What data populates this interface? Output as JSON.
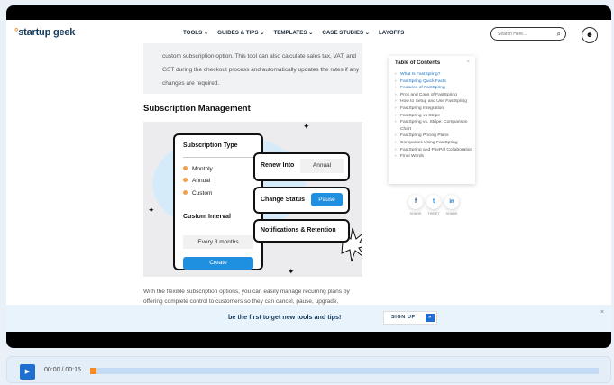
{
  "nav": {
    "logo_brand": "startup geek",
    "menu": [
      "TOOLS",
      "GUIDES & TIPS",
      "TEMPLATES",
      "CASE STUDIES",
      "LAYOFFS"
    ],
    "search_placeholder": "Search Here...",
    "dropdown_marks": [
      "⌄",
      "⌄",
      "⌄",
      "⌄"
    ]
  },
  "content": {
    "intro_text": "custom subscription option. This tool can also calculate sales tax, VAT, and GST during the checkout process and automatically updates the rates if any changes are required.",
    "heading": "Subscription Management",
    "paragraph": "With the flexible subscription options, you can easily manage recurring plans by offering complete control to customers so they can cancel, pause, upgrade,"
  },
  "illustration": {
    "card_title": "Subscription Type",
    "options": [
      "Monthly",
      "Annual",
      "Custom"
    ],
    "custom_interval": "Custom Interval",
    "every_value": "Every 3 months",
    "create_label": "Create",
    "renew_label": "Renew Into",
    "renew_value": "Annual",
    "status_label": "Change Status",
    "status_value": "Pause",
    "notifications_label": "Notifications & Retention",
    "bullet_color": "#f0a04b",
    "button_color": "#1f8fe0"
  },
  "toc": {
    "title": "Table of Contents",
    "close": "×",
    "items": [
      {
        "label": "What Is FastSpring?",
        "active": true
      },
      {
        "label": "FastSpring Quick Facts",
        "active": true
      },
      {
        "label": "Features of FastSpring",
        "active": true
      },
      {
        "label": "Pros and Cons of FastSpring",
        "active": false
      },
      {
        "label": "How to Setup and Use FastSpring",
        "active": false
      },
      {
        "label": "FastSpring Integration",
        "active": false
      },
      {
        "label": "FastSpring vs Stripe",
        "active": false
      },
      {
        "label": "FastSpring vs. Stripe: Comparison Chart",
        "active": false
      },
      {
        "label": "FastSpring Pricing Plans",
        "active": false
      },
      {
        "label": "Companies Using FastSpring",
        "active": false
      },
      {
        "label": "FastSpring and PayPal Collaboration",
        "active": false
      },
      {
        "label": "Final Words",
        "active": false
      }
    ]
  },
  "share": [
    {
      "icon": "f",
      "label": "SHARE",
      "color": "#3b5998"
    },
    {
      "icon": "t",
      "label": "TWEET",
      "color": "#1da1f2"
    },
    {
      "icon": "in",
      "label": "SHARE",
      "color": "#0a66c2"
    }
  ],
  "banner": {
    "message": "be the first to get new tools and tips!",
    "signup_label": "SIGN UP",
    "arrow": "»",
    "close": "×"
  },
  "player": {
    "time": "00:00 / 00:15",
    "play_icon": "▶",
    "progress": 0.0
  }
}
